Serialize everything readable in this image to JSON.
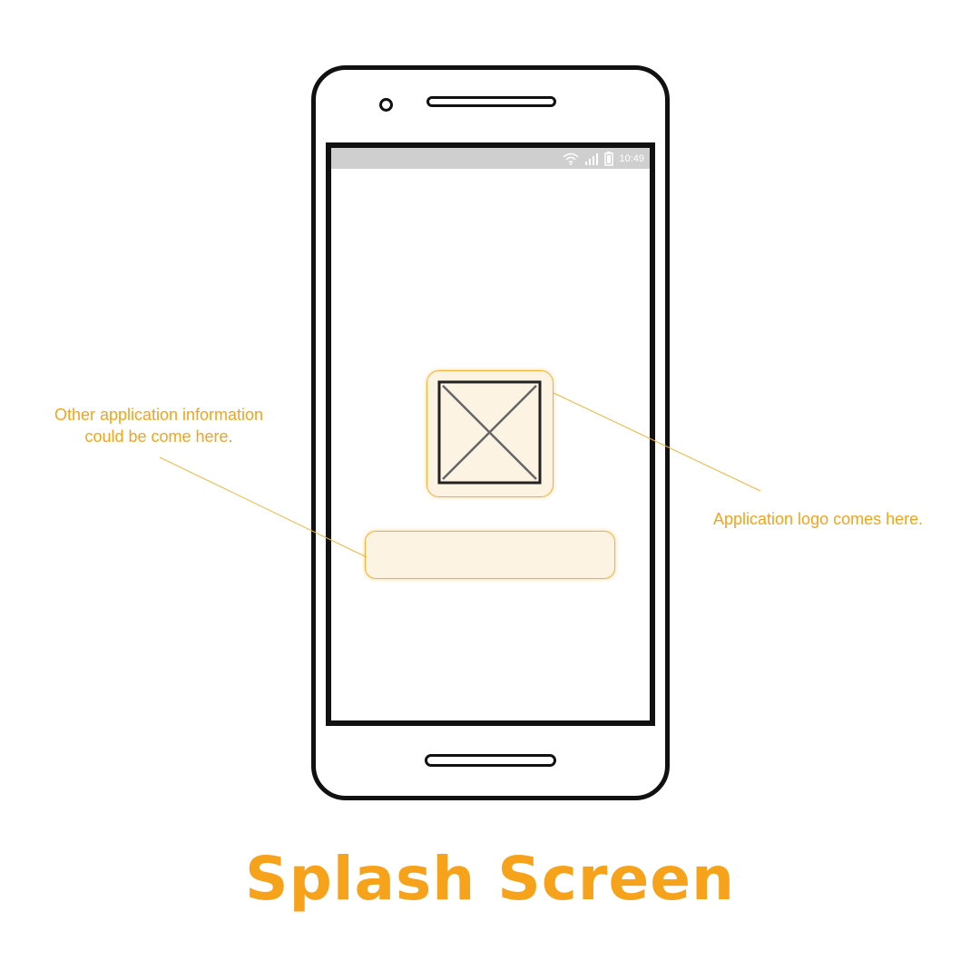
{
  "status_bar": {
    "time": "10:49",
    "icons": [
      "wifi-icon",
      "signal-icon",
      "battery-icon"
    ]
  },
  "logo_placeholder": {
    "icon": "image-placeholder-icon"
  },
  "annotations": {
    "info_line1": "Other application information",
    "info_line2": "could be come here.",
    "logo_note": "Application logo comes here."
  },
  "title": "Splash Screen",
  "colors": {
    "accent": "#f5a31a",
    "status_bar": "#cfcfcf",
    "outline": "#111111",
    "highlight_fill": "#fdf3e3"
  }
}
